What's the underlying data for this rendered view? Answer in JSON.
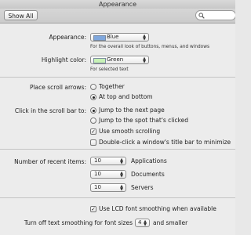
{
  "window": {
    "title": "Appearance"
  },
  "toolbar": {
    "show_all_label": "Show All",
    "search_placeholder": ""
  },
  "appearance": {
    "label": "Appearance:",
    "value": "Blue",
    "swatch_color": "#7fa7dd",
    "description": "For the overall look of buttons, menus, and windows"
  },
  "highlight": {
    "label": "Highlight color:",
    "value": "Green",
    "swatch_color": "#c8f2b6",
    "description": "For selected text"
  },
  "scroll_arrows": {
    "label": "Place scroll arrows:",
    "options": [
      "Together",
      "At top and bottom"
    ],
    "selected_index": 1
  },
  "scroll_bar_click": {
    "label": "Click in the scroll bar to:",
    "options": [
      "Jump to the next page",
      "Jump to the spot that's clicked"
    ],
    "selected_index": 0
  },
  "checkboxes": {
    "smooth_scrolling": {
      "label": "Use smooth scrolling",
      "checked": true
    },
    "double_click_minimize": {
      "label": "Double-click a window's title bar to minimize",
      "checked": false
    }
  },
  "recent_items": {
    "label": "Number of recent items:",
    "rows": [
      {
        "value": "10",
        "label": "Applications"
      },
      {
        "value": "10",
        "label": "Documents"
      },
      {
        "value": "10",
        "label": "Servers"
      }
    ]
  },
  "font_smoothing": {
    "lcd_label": "Use LCD font smoothing when available",
    "lcd_checked": true,
    "turn_off_label": "Turn off text smoothing for font sizes",
    "size_value": "4",
    "suffix": "and smaller"
  }
}
